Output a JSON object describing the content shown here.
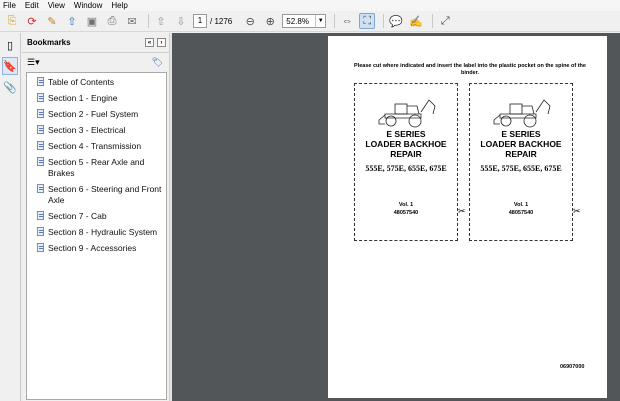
{
  "menu": [
    "File",
    "Edit",
    "View",
    "Window",
    "Help"
  ],
  "toolbar": {
    "page_current": "1",
    "page_total": "/ 1276",
    "zoom": "52.8%"
  },
  "bookmarks": {
    "title": "Bookmarks",
    "items": [
      "Table of Contents",
      "Section 1 - Engine",
      "Section 2 - Fuel System",
      "Section 3 - Electrical",
      "Section 4 - Transmission",
      "Section 5 - Rear Axle and Brakes",
      "Section 6 - Steering and Front Axle",
      "Section 7 - Cab",
      "Section 8 - Hydraulic System",
      "Section 9 - Accessories"
    ]
  },
  "document": {
    "instruction": "Please cut where indicated and insert the label into the plastic pocket on the spine of the binder.",
    "label": {
      "series": "E SERIES",
      "name_line1": "LOADER BACKHOE",
      "name_line2": "REPAIR",
      "models": "555E, 575E, 655E, 675E",
      "vol": "Vol. 1",
      "number": "48057540"
    },
    "page_code": "06907000"
  },
  "icons": [
    "open-icon",
    "create-pdf-icon",
    "edit-icon",
    "upload-icon",
    "save-icon",
    "print-icon",
    "email-icon",
    "prev-page-icon",
    "next-page-icon",
    "zoom-out-icon",
    "zoom-in-icon",
    "fit-width-icon",
    "fit-page-icon",
    "comment-icon",
    "sign-icon",
    "expand-icon"
  ]
}
